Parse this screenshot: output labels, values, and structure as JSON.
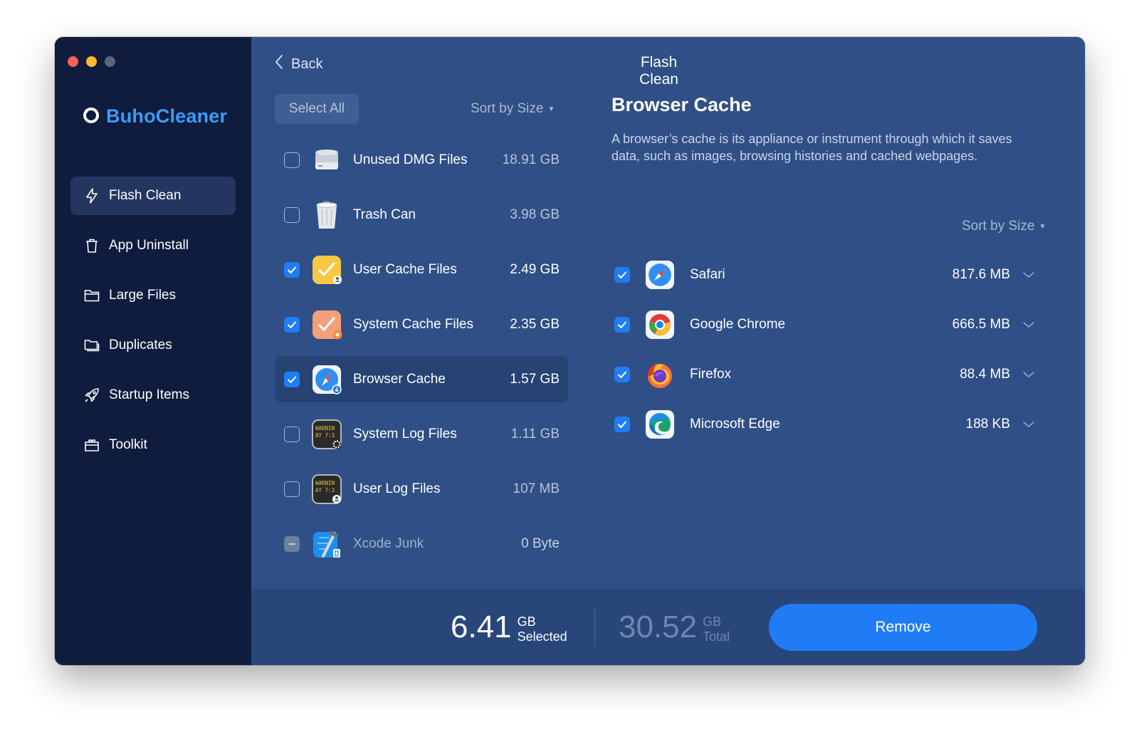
{
  "app": {
    "name": "BuhoCleaner"
  },
  "colors": {
    "accent": "#1f7cf5",
    "brand": "#3b9cff",
    "sidebar": "#0f1c3d",
    "main": "#2f4f86"
  },
  "sidebar": {
    "items": [
      {
        "label": "Flash Clean",
        "icon": "bolt-icon",
        "active": true
      },
      {
        "label": "App Uninstall",
        "icon": "trash-icon"
      },
      {
        "label": "Large Files",
        "icon": "folder-icon"
      },
      {
        "label": "Duplicates",
        "icon": "duplicates-icon"
      },
      {
        "label": "Startup Items",
        "icon": "rocket-icon"
      },
      {
        "label": "Toolkit",
        "icon": "toolkit-icon"
      }
    ]
  },
  "header": {
    "back_label": "Back",
    "title": "Flash Clean"
  },
  "list": {
    "select_all_label": "Select All",
    "sort_label": "Sort by Size",
    "items": [
      {
        "label": "Unused DMG Files",
        "size": "18.91 GB",
        "checked": false,
        "icon": "disk-icon"
      },
      {
        "label": "Trash Can",
        "size": "3.98 GB",
        "checked": false,
        "icon": "trash-can-icon"
      },
      {
        "label": "User Cache Files",
        "size": "2.49 GB",
        "checked": true,
        "icon": "user-cache-icon"
      },
      {
        "label": "System Cache Files",
        "size": "2.35 GB",
        "checked": true,
        "icon": "system-cache-icon"
      },
      {
        "label": "Browser Cache",
        "size": "1.57 GB",
        "checked": true,
        "icon": "browser-cache-icon",
        "active": true
      },
      {
        "label": "System Log Files",
        "size": "1.11 GB",
        "checked": false,
        "icon": "system-log-icon"
      },
      {
        "label": "User Log Files",
        "size": "107 MB",
        "checked": false,
        "icon": "user-log-icon"
      },
      {
        "label": "Xcode Junk",
        "size": "0 Byte",
        "checked": false,
        "icon": "xcode-icon",
        "disabled": true
      }
    ]
  },
  "detail": {
    "title": "Browser Cache",
    "description": "A browser’s cache is its appliance or instrument through which it saves data, such as images, browsing histories and cached webpages.",
    "sort_label": "Sort by Size",
    "browsers": [
      {
        "label": "Safari",
        "size": "817.6 MB",
        "checked": true,
        "icon": "safari-icon"
      },
      {
        "label": "Google Chrome",
        "size": "666.5 MB",
        "checked": true,
        "icon": "chrome-icon"
      },
      {
        "label": "Firefox",
        "size": "88.4 MB",
        "checked": true,
        "icon": "firefox-icon"
      },
      {
        "label": "Microsoft Edge",
        "size": "188 KB",
        "checked": true,
        "icon": "edge-icon"
      }
    ]
  },
  "footer": {
    "selected_value": "6.41",
    "selected_unit": "GB",
    "selected_label": "Selected",
    "total_value": "30.52",
    "total_unit": "GB",
    "total_label": "Total",
    "remove_label": "Remove"
  }
}
